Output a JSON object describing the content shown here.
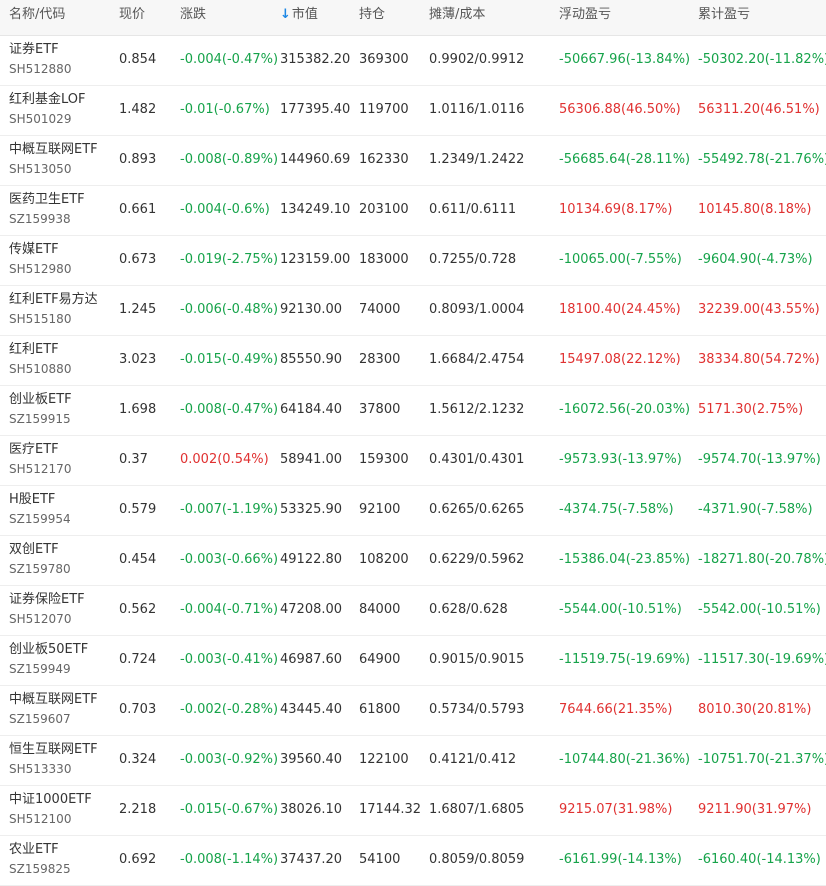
{
  "header": {
    "name_code": "名称/代码",
    "price": "现价",
    "change": "涨跌",
    "sort_arrow": "↓",
    "market_value": "市值",
    "holdings": "持仓",
    "cost": "摊薄/成本",
    "floating_pl": "浮动盈亏",
    "cumulative_pl": "累计盈亏"
  },
  "colors": {
    "up": "#e03131",
    "down": "#16a34a",
    "sort_arrow": "#1e88e5",
    "header_bg": "#f7f7f7"
  },
  "rows": [
    {
      "name": "证券ETF",
      "code": "SH512880",
      "price": "0.854",
      "change": "-0.004(-0.47%)",
      "change_dir": "down",
      "market_value": "315382.20",
      "holdings": "369300",
      "cost": "0.9902/0.9912",
      "floating_pl": "-50667.96(-13.84%)",
      "floating_dir": "down",
      "cumulative_pl": "-50302.20(-11.82%)",
      "cumulative_dir": "down"
    },
    {
      "name": "红利基金LOF",
      "code": "SH501029",
      "price": "1.482",
      "change": "-0.01(-0.67%)",
      "change_dir": "down",
      "market_value": "177395.40",
      "holdings": "119700",
      "cost": "1.0116/1.0116",
      "floating_pl": "56306.88(46.50%)",
      "floating_dir": "up",
      "cumulative_pl": "56311.20(46.51%)",
      "cumulative_dir": "up"
    },
    {
      "name": "中概互联网ETF",
      "code": "SH513050",
      "price": "0.893",
      "change": "-0.008(-0.89%)",
      "change_dir": "down",
      "market_value": "144960.69",
      "holdings": "162330",
      "cost": "1.2349/1.2422",
      "floating_pl": "-56685.64(-28.11%)",
      "floating_dir": "down",
      "cumulative_pl": "-55492.78(-21.76%)",
      "cumulative_dir": "down"
    },
    {
      "name": "医药卫生ETF",
      "code": "SZ159938",
      "price": "0.661",
      "change": "-0.004(-0.6%)",
      "change_dir": "down",
      "market_value": "134249.10",
      "holdings": "203100",
      "cost": "0.611/0.6111",
      "floating_pl": "10134.69(8.17%)",
      "floating_dir": "up",
      "cumulative_pl": "10145.80(8.18%)",
      "cumulative_dir": "up"
    },
    {
      "name": "传媒ETF",
      "code": "SH512980",
      "price": "0.673",
      "change": "-0.019(-2.75%)",
      "change_dir": "down",
      "market_value": "123159.00",
      "holdings": "183000",
      "cost": "0.7255/0.728",
      "floating_pl": "-10065.00(-7.55%)",
      "floating_dir": "down",
      "cumulative_pl": "-9604.90(-4.73%)",
      "cumulative_dir": "down"
    },
    {
      "name": "红利ETF易方达",
      "code": "SH515180",
      "price": "1.245",
      "change": "-0.006(-0.48%)",
      "change_dir": "down",
      "market_value": "92130.00",
      "holdings": "74000",
      "cost": "0.8093/1.0004",
      "floating_pl": "18100.40(24.45%)",
      "floating_dir": "up",
      "cumulative_pl": "32239.00(43.55%)",
      "cumulative_dir": "up"
    },
    {
      "name": "红利ETF",
      "code": "SH510880",
      "price": "3.023",
      "change": "-0.015(-0.49%)",
      "change_dir": "down",
      "market_value": "85550.90",
      "holdings": "28300",
      "cost": "1.6684/2.4754",
      "floating_pl": "15497.08(22.12%)",
      "floating_dir": "up",
      "cumulative_pl": "38334.80(54.72%)",
      "cumulative_dir": "up"
    },
    {
      "name": "创业板ETF",
      "code": "SZ159915",
      "price": "1.698",
      "change": "-0.008(-0.47%)",
      "change_dir": "down",
      "market_value": "64184.40",
      "holdings": "37800",
      "cost": "1.5612/2.1232",
      "floating_pl": "-16072.56(-20.03%)",
      "floating_dir": "down",
      "cumulative_pl": "5171.30(2.75%)",
      "cumulative_dir": "up"
    },
    {
      "name": "医疗ETF",
      "code": "SH512170",
      "price": "0.37",
      "change": "0.002(0.54%)",
      "change_dir": "up",
      "market_value": "58941.00",
      "holdings": "159300",
      "cost": "0.4301/0.4301",
      "floating_pl": "-9573.93(-13.97%)",
      "floating_dir": "down",
      "cumulative_pl": "-9574.70(-13.97%)",
      "cumulative_dir": "down"
    },
    {
      "name": "H股ETF",
      "code": "SZ159954",
      "price": "0.579",
      "change": "-0.007(-1.19%)",
      "change_dir": "down",
      "market_value": "53325.90",
      "holdings": "92100",
      "cost": "0.6265/0.6265",
      "floating_pl": "-4374.75(-7.58%)",
      "floating_dir": "down",
      "cumulative_pl": "-4371.90(-7.58%)",
      "cumulative_dir": "down"
    },
    {
      "name": "双创ETF",
      "code": "SZ159780",
      "price": "0.454",
      "change": "-0.003(-0.66%)",
      "change_dir": "down",
      "market_value": "49122.80",
      "holdings": "108200",
      "cost": "0.6229/0.5962",
      "floating_pl": "-15386.04(-23.85%)",
      "floating_dir": "down",
      "cumulative_pl": "-18271.80(-20.78%)",
      "cumulative_dir": "down"
    },
    {
      "name": "证券保险ETF",
      "code": "SH512070",
      "price": "0.562",
      "change": "-0.004(-0.71%)",
      "change_dir": "down",
      "market_value": "47208.00",
      "holdings": "84000",
      "cost": "0.628/0.628",
      "floating_pl": "-5544.00(-10.51%)",
      "floating_dir": "down",
      "cumulative_pl": "-5542.00(-10.51%)",
      "cumulative_dir": "down"
    },
    {
      "name": "创业板50ETF",
      "code": "SZ159949",
      "price": "0.724",
      "change": "-0.003(-0.41%)",
      "change_dir": "down",
      "market_value": "46987.60",
      "holdings": "64900",
      "cost": "0.9015/0.9015",
      "floating_pl": "-11519.75(-19.69%)",
      "floating_dir": "down",
      "cumulative_pl": "-11517.30(-19.69%)",
      "cumulative_dir": "down"
    },
    {
      "name": "中概互联网ETF",
      "code": "SZ159607",
      "price": "0.703",
      "change": "-0.002(-0.28%)",
      "change_dir": "down",
      "market_value": "43445.40",
      "holdings": "61800",
      "cost": "0.5734/0.5793",
      "floating_pl": "7644.66(21.35%)",
      "floating_dir": "up",
      "cumulative_pl": "8010.30(20.81%)",
      "cumulative_dir": "up"
    },
    {
      "name": "恒生互联网ETF",
      "code": "SH513330",
      "price": "0.324",
      "change": "-0.003(-0.92%)",
      "change_dir": "down",
      "market_value": "39560.40",
      "holdings": "122100",
      "cost": "0.4121/0.412",
      "floating_pl": "-10744.80(-21.36%)",
      "floating_dir": "down",
      "cumulative_pl": "-10751.70(-21.37%)",
      "cumulative_dir": "down"
    },
    {
      "name": "中证1000ETF",
      "code": "SH512100",
      "price": "2.218",
      "change": "-0.015(-0.67%)",
      "change_dir": "down",
      "market_value": "38026.10",
      "holdings": "17144.32",
      "cost": "1.6807/1.6805",
      "floating_pl": "9215.07(31.98%)",
      "floating_dir": "up",
      "cumulative_pl": "9211.90(31.97%)",
      "cumulative_dir": "up"
    },
    {
      "name": "农业ETF",
      "code": "SZ159825",
      "price": "0.692",
      "change": "-0.008(-1.14%)",
      "change_dir": "down",
      "market_value": "37437.20",
      "holdings": "54100",
      "cost": "0.8059/0.8059",
      "floating_pl": "-6161.99(-14.13%)",
      "floating_dir": "down",
      "cumulative_pl": "-6160.40(-14.13%)",
      "cumulative_dir": "down"
    }
  ]
}
